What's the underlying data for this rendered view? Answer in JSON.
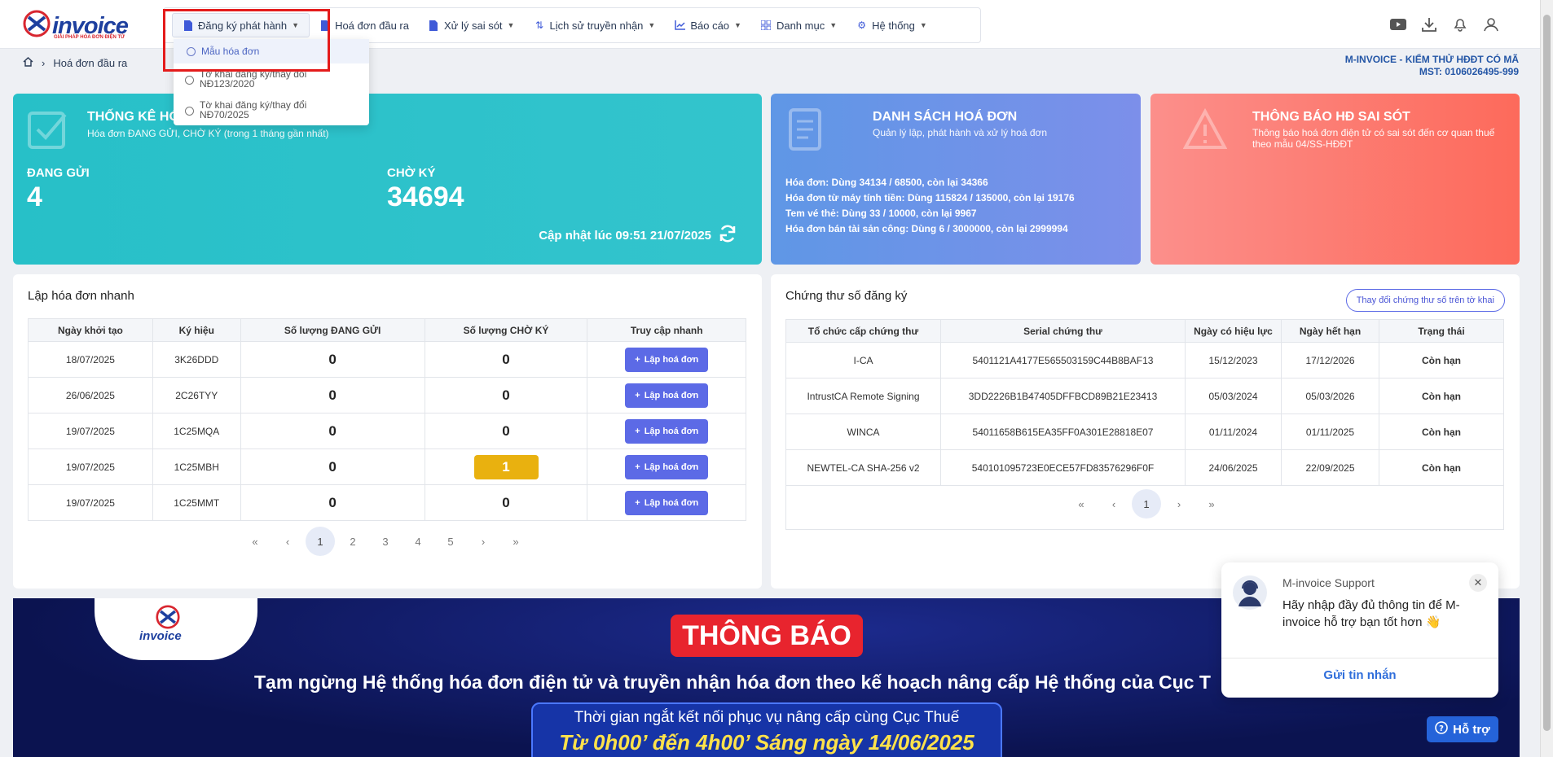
{
  "app": {
    "logo_text": "invoice",
    "logo_sub": "GIẢI PHÁP HÓA ĐƠN ĐIỆN TỬ"
  },
  "nav": {
    "items": [
      {
        "label": "Đăng ký phát hành",
        "icon": "file-register-icon"
      },
      {
        "label": "Hoá đơn đầu ra",
        "icon": "file-output-icon"
      },
      {
        "label": "Xử lý sai sót",
        "icon": "file-error-icon"
      },
      {
        "label": "Lịch sử truyền nhận",
        "icon": "transfer-icon"
      },
      {
        "label": "Báo cáo",
        "icon": "chart-icon"
      },
      {
        "label": "Danh mục",
        "icon": "grid-icon"
      },
      {
        "label": "Hệ thống",
        "icon": "gear-icon"
      }
    ],
    "dropdown": [
      {
        "label": "Mẫu hóa đơn"
      },
      {
        "label": "Tờ khai đăng ký/thay đổi NĐ123/2020"
      },
      {
        "label": "Tờ khai đăng ký/thay đổi NĐ70/2025"
      }
    ]
  },
  "breadcrumb": {
    "current": "Hoá đơn đầu ra"
  },
  "company": {
    "name": "M-INVOICE - KIỂM THỬ HĐĐT CÓ MÃ",
    "mst": "MST: 0106026495-999"
  },
  "stats": {
    "title": "THỐNG KÊ HÓ",
    "subtitle": "Hóa đơn ĐANG GỬI, CHỜ KÝ (trong 1 tháng gần nhất)",
    "sending_label": "ĐANG GỬI",
    "sending_value": "4",
    "waiting_label": "CHỜ KÝ",
    "waiting_value": "34694",
    "updated": "Cập nhật lúc 09:51 21/07/2025"
  },
  "invoice_list": {
    "title": "DANH SÁCH HOÁ ĐƠN",
    "subtitle": "Quản lý lập, phát hành và xử lý hoá đơn",
    "lines": [
      "Hóa đơn: Dùng 34134 / 68500, còn lại 34366",
      "Hóa đơn từ máy tính tiền: Dùng 115824 / 135000, còn lại 19176",
      "Tem vé thẻ: Dùng 33 / 10000, còn lại 9967",
      "Hóa đơn bán tài sản công: Dùng 6 / 3000000, còn lại 2999994"
    ]
  },
  "error_notice": {
    "title": "THÔNG BÁO HĐ SAI SÓT",
    "subtitle": "Thông báo hoá đơn điện tử có sai sót đến cơ quan thuế theo mẫu 04/SS-HĐĐT"
  },
  "quick": {
    "title": "Lập hóa đơn nhanh",
    "columns": [
      "Ngày khởi tạo",
      "Ký hiệu",
      "Số lượng ĐANG GỬI",
      "Số lượng CHỜ KÝ",
      "Truy cập nhanh"
    ],
    "button_label": "Lập hoá đơn",
    "rows": [
      {
        "date": "18/07/2025",
        "code": "3K26DDD",
        "sending": "0",
        "waiting": "0"
      },
      {
        "date": "26/06/2025",
        "code": "2C26TYY",
        "sending": "0",
        "waiting": "0"
      },
      {
        "date": "19/07/2025",
        "code": "1C25MQA",
        "sending": "0",
        "waiting": "0"
      },
      {
        "date": "19/07/2025",
        "code": "1C25MBH",
        "sending": "0",
        "waiting": "1"
      },
      {
        "date": "19/07/2025",
        "code": "1C25MMT",
        "sending": "0",
        "waiting": "0"
      }
    ],
    "pages": [
      "«",
      "‹",
      "1",
      "2",
      "3",
      "4",
      "5",
      "›",
      "»"
    ]
  },
  "certs": {
    "title": "Chứng thư số đăng ký",
    "change_label": "Thay đổi chứng thư số trên tờ khai",
    "columns": [
      "Tổ chức cấp chứng thư",
      "Serial chứng thư",
      "Ngày có hiệu lực",
      "Ngày hết hạn",
      "Trạng thái"
    ],
    "rows": [
      {
        "org": "I-CA",
        "serial": "5401121A4177E565503159C44B8BAF13",
        "from": "15/12/2023",
        "to": "17/12/2026",
        "status": "Còn hạn"
      },
      {
        "org": "IntrustCA Remote Signing",
        "serial": "3DD2226B1B47405DFFBCD89B21E23413",
        "from": "05/03/2024",
        "to": "05/03/2026",
        "status": "Còn hạn"
      },
      {
        "org": "WINCA",
        "serial": "54011658B615EA35FF0A301E28818E07",
        "from": "01/11/2024",
        "to": "01/11/2025",
        "status": "Còn hạn"
      },
      {
        "org": "NEWTEL-CA SHA-256 v2",
        "serial": "540101095723E0ECE57FD83576296F0F",
        "from": "24/06/2025",
        "to": "22/09/2025",
        "status": "Còn hạn"
      }
    ],
    "pages": [
      "«",
      "‹",
      "1",
      "›",
      "»"
    ]
  },
  "banner": {
    "logo_text": "invoice",
    "title": "THÔNG BÁO",
    "line": "Tạm ngừng Hệ thống hóa đơn điện tử và truyền nhận hóa đơn theo kế hoạch nâng cấp Hệ thống của Cục T",
    "box_line1": "Thời gian ngắt kết nối phục vụ nâng cấp cùng Cục Thuế",
    "box_line2": "Từ 0h00’ đến 4h00’ Sáng ngày 14/06/2025"
  },
  "support": {
    "name": "M-invoice Support",
    "message": "Hãy nhập đầy đủ thông tin để M-invoice hỗ trợ bạn tốt hơn 👋",
    "send": "Gửi tin nhắn",
    "help": "Hỗ trợ"
  }
}
